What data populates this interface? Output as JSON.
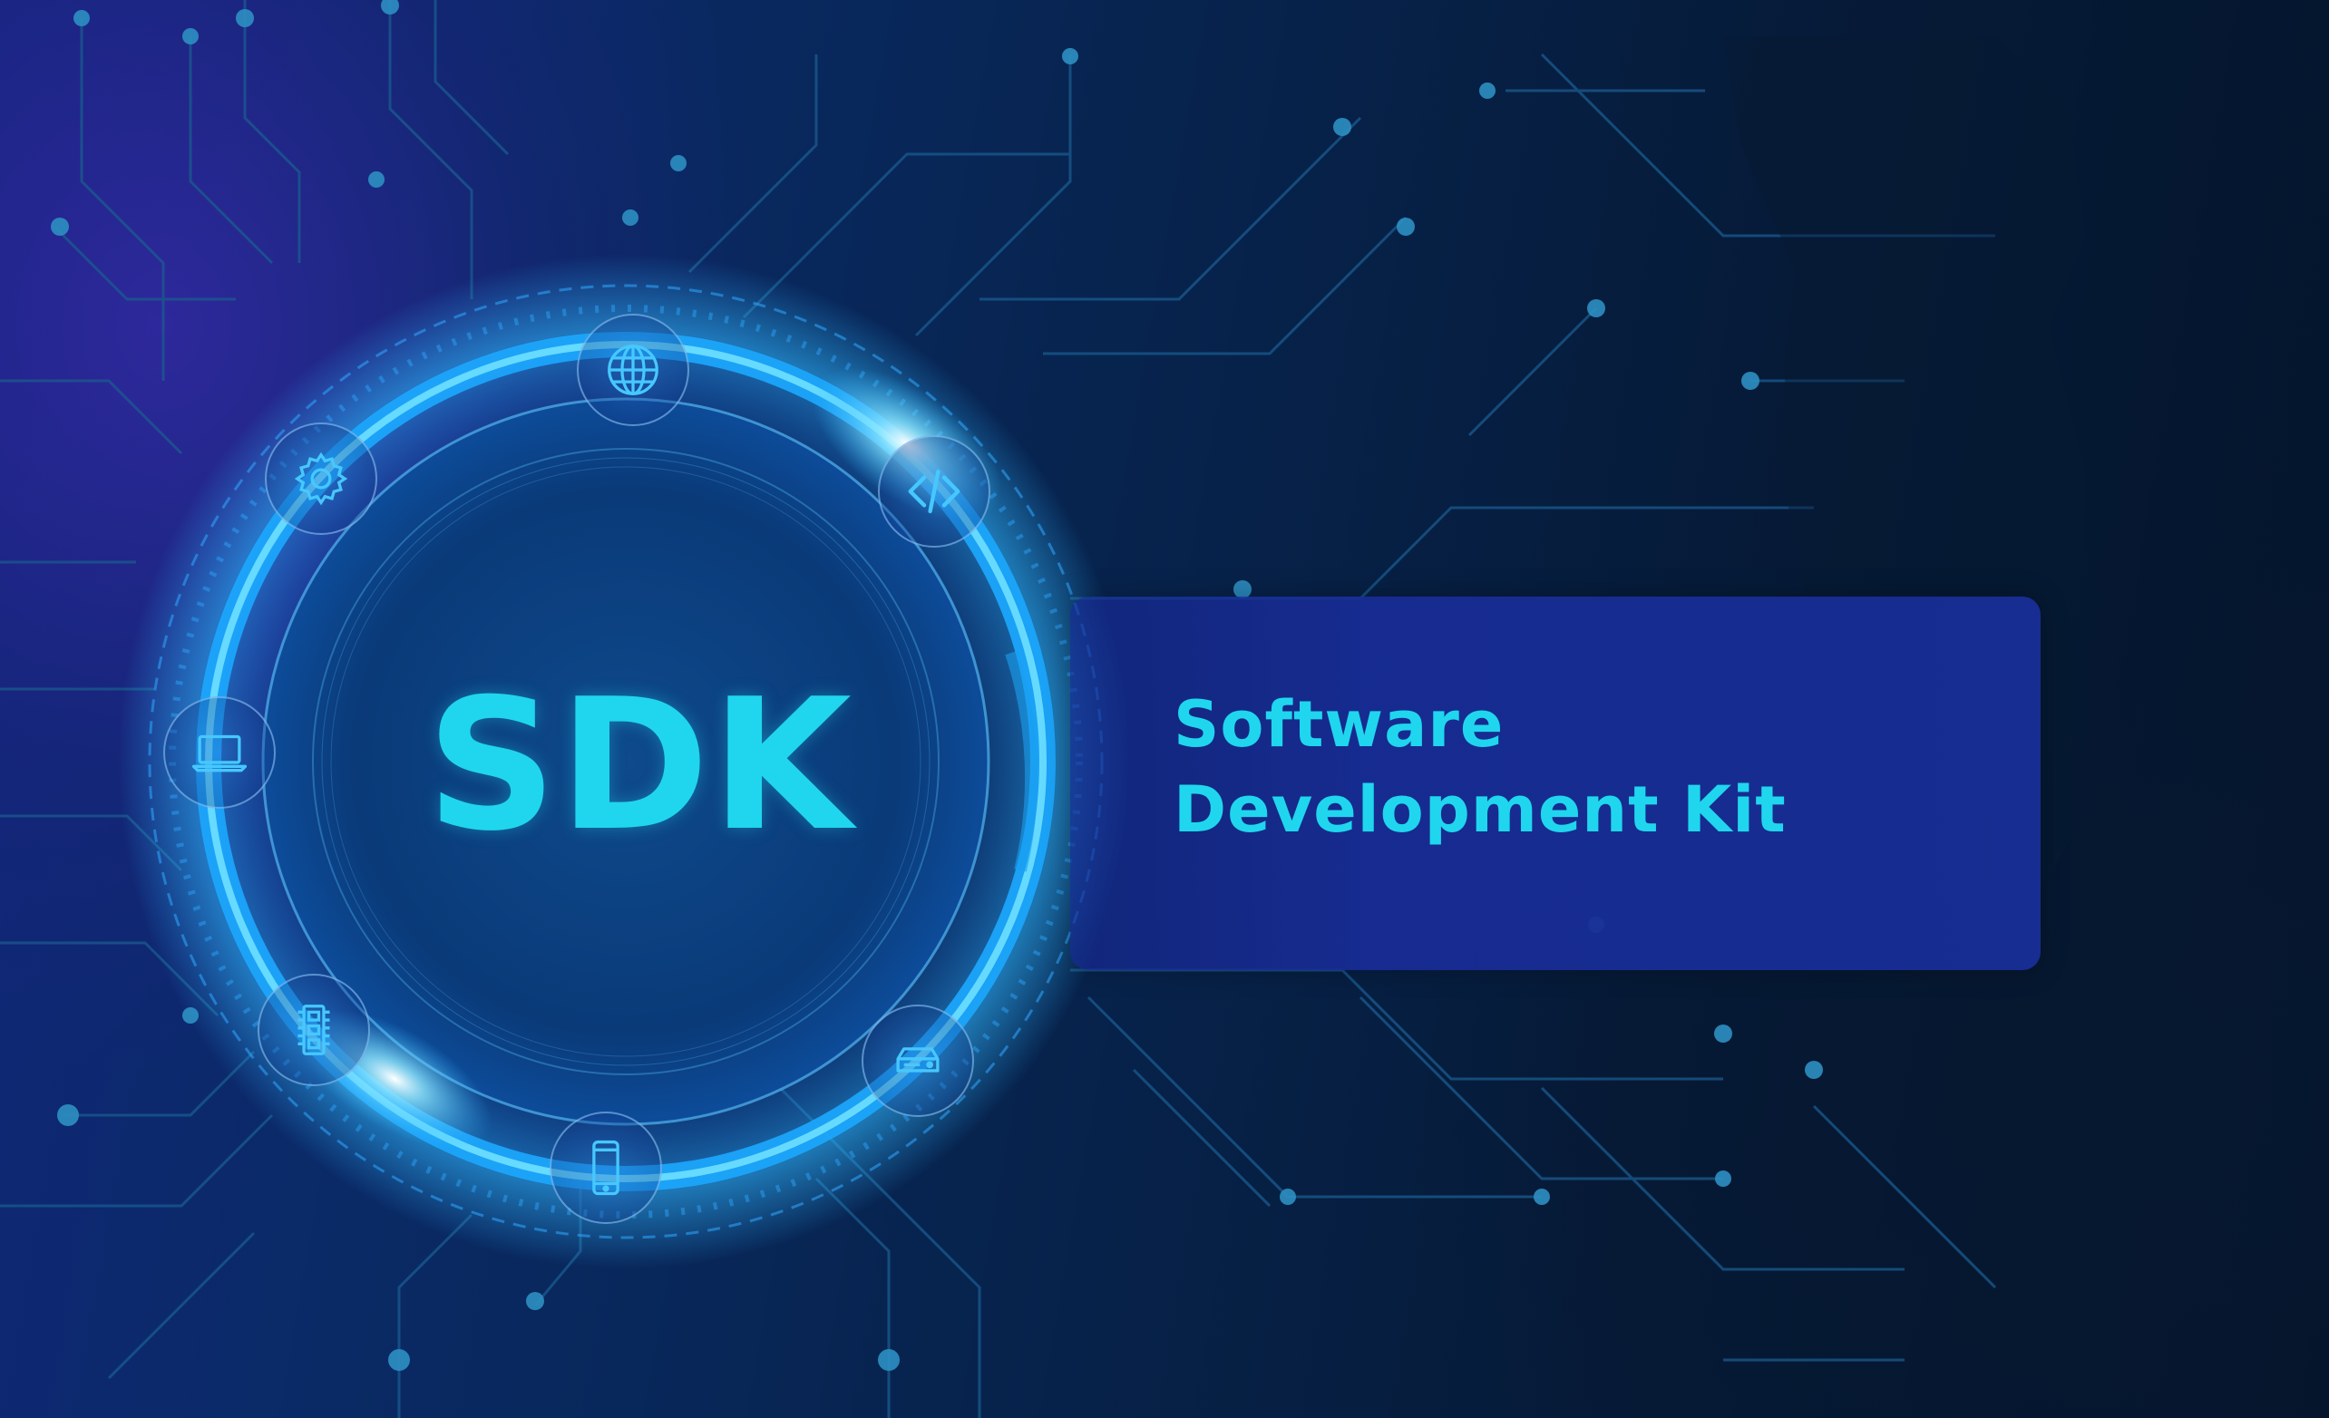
{
  "hero": {
    "acronym": "SDK",
    "subtitle_line1": "Software",
    "subtitle_line2": "Development Kit"
  },
  "icons": [
    "globe-icon",
    "code-icon",
    "gear-icon",
    "laptop-icon",
    "memory-chip-icon",
    "smartphone-icon",
    "hard-drive-icon"
  ],
  "colors": {
    "accent": "#1fd6ee",
    "background": "#06142a",
    "panel": "#182e96",
    "glow": "#2fb8ff"
  }
}
